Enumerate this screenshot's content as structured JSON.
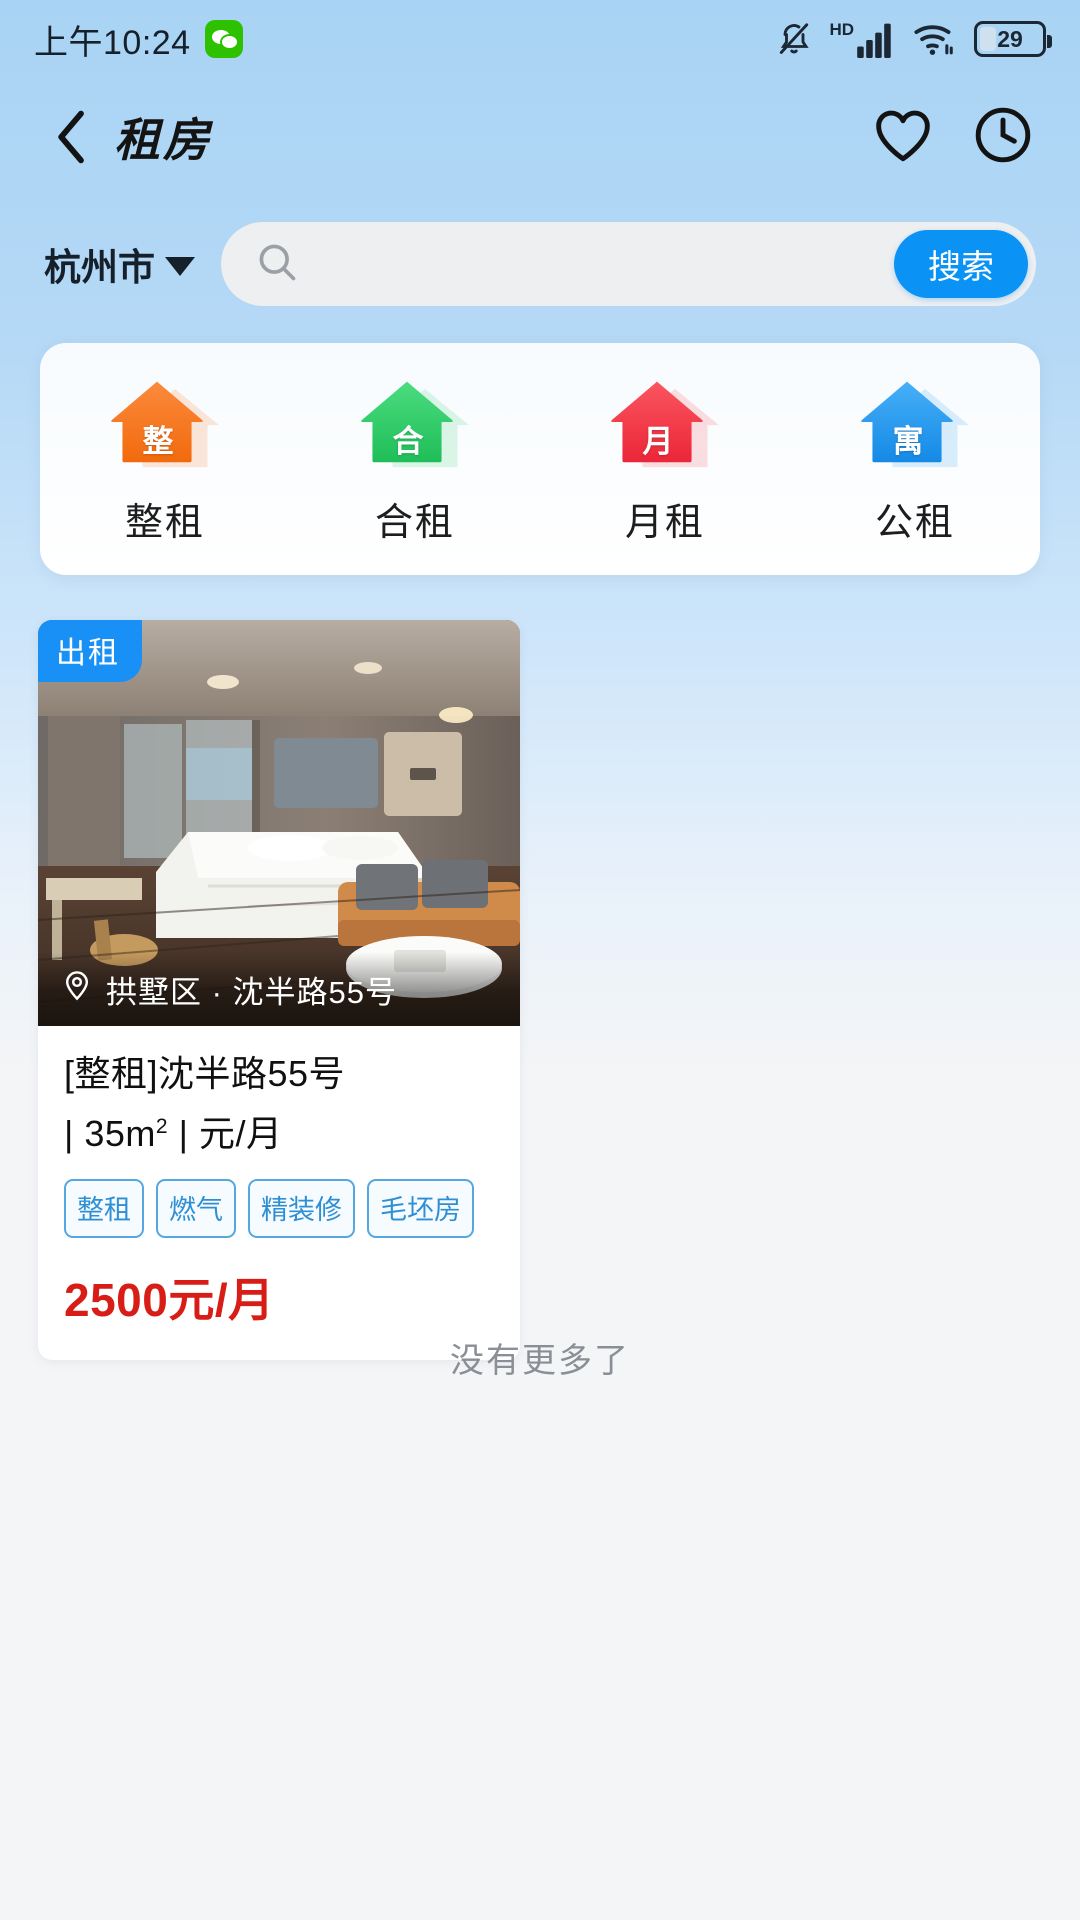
{
  "statusbar": {
    "time": "上午10:24",
    "battery_level": "29",
    "icons": [
      "wechat-icon",
      "bell-muted-icon",
      "hd-signal-icon",
      "wifi-icon",
      "battery-icon"
    ],
    "hd_label": "HD"
  },
  "header": {
    "title": "租房",
    "back_icon": "chevron-left-icon",
    "favorite_icon": "heart-icon",
    "history_icon": "clock-icon"
  },
  "search": {
    "city": "杭州市",
    "placeholder": "",
    "value": "",
    "button_label": "搜索",
    "search_icon": "search-icon",
    "accent_color": "#0a92f5"
  },
  "categories": [
    {
      "glyph": "整",
      "label": "整租",
      "color": "#f87424",
      "color_dark": "#ef6a14"
    },
    {
      "glyph": "合",
      "label": "合租",
      "color": "#3ed173",
      "color_dark": "#22c45f"
    },
    {
      "glyph": "月",
      "label": "月租",
      "color": "#f8444f",
      "color_dark": "#ee2f3f"
    },
    {
      "glyph": "寓",
      "label": "公租",
      "color": "#34a2f0",
      "color_dark": "#1b90e8"
    }
  ],
  "listings": [
    {
      "badge": "出租",
      "location": "拱墅区 · 沈半路55号",
      "location_icon": "map-pin-icon",
      "title": "[整租]沈半路55号",
      "area": "35",
      "area_unit": "m",
      "sub_suffix": "| 元/月",
      "tags": [
        "整租",
        "燃气",
        "精装修",
        "毛坯房"
      ],
      "price": "2500元/月",
      "price_color": "#d81c16"
    }
  ],
  "footer": {
    "no_more": "没有更多了"
  }
}
